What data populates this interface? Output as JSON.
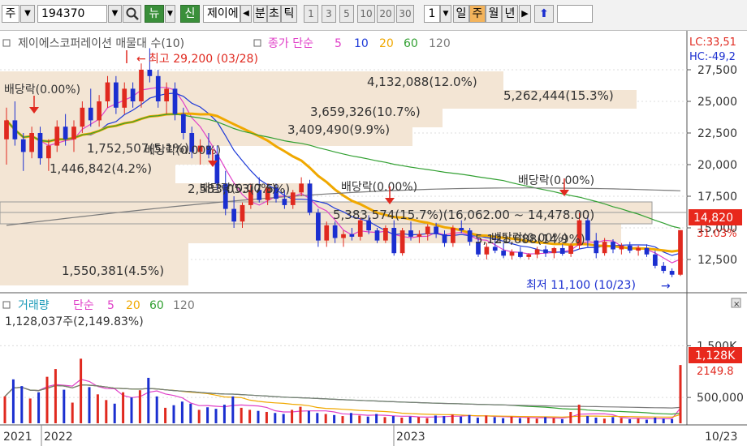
{
  "toolbar": {
    "market_type": "주",
    "code": "194370",
    "search_icon": "search-icon",
    "news_btn": "뉴",
    "new_btn": "신",
    "stock_name": "제이에",
    "nav_left_icon": "triangle-left-icon",
    "period_labels": [
      "분",
      "초",
      "틱"
    ],
    "interval_options": [
      "1",
      "3",
      "5",
      "10",
      "20",
      "30"
    ],
    "count_value": "1",
    "timeframes": [
      "일",
      "주",
      "월",
      "년"
    ],
    "selected_timeframe": "주",
    "nav_right_icon": "triangle-right-icon",
    "up_icon": "up-arrow-icon"
  },
  "price_panel": {
    "legend": {
      "title": "제이에스코퍼레이션 매물대 수(10)",
      "ma_label": "종가 단순",
      "periods": [
        "5",
        "10",
        "20",
        "60",
        "120"
      ]
    },
    "lc_label": "LC:33,51",
    "hc_label": "HC:-49,2",
    "high_marker": "최고 29,200 (03/28)",
    "low_marker": "최저 11,100 (10/23)",
    "dividend_labels": [
      "배당락(0.00%)",
      "배당락(0.00%)",
      "배당락(0.00%)",
      "배당락(0.00%)",
      "배당락(0.00%)",
      "배당락(0.00%)"
    ],
    "volume_profile": [
      {
        "text": "4,132,088(12.0%)"
      },
      {
        "text": "5,262,444(15.3%)"
      },
      {
        "text": "3,659,326(10.7%)"
      },
      {
        "text": "3,409,490(9.9%)"
      },
      {
        "text": "1,752,507(5.1%)"
      },
      {
        "text": "1,446,842(4.2%)"
      },
      {
        "text": "2,583,053(7.5%)"
      },
      {
        "text": "5,383,574(15.7%)(16,062.00 ~ 14,478.00)"
      },
      {
        "text": "5,121,088(14.9%)"
      },
      {
        "text": "1,550,381(4.5%)"
      }
    ],
    "current_price": "14,820",
    "current_change": "31.03%"
  },
  "volume_panel": {
    "legend": {
      "title": "거래량",
      "ma_label": "단순",
      "periods": [
        "5",
        "20",
        "60",
        "120"
      ]
    },
    "last_value_label": "1,128,037주(2,149.83%)",
    "current_volume": "1,128K",
    "current_change": "2149.8",
    "close_icon": "close-icon"
  },
  "x_axis": {
    "labels": [
      "2021",
      "2022",
      "2023",
      "10/23"
    ]
  },
  "colors": {
    "up": "#e0291f",
    "down": "#1b2fd0",
    "ma5": "#e040c8",
    "ma10": "#1e3ad8",
    "ma20": "#f0a800",
    "ma60": "#32a032",
    "ma120": "#7a7a7a",
    "profile_fill": "#f3e5d4",
    "price_tag": "#e8281c"
  },
  "chart_data": {
    "type": "candlestick",
    "price_axis": {
      "ticks": [
        12500,
        15000,
        17500,
        20000,
        22500,
        25000,
        27500
      ],
      "ylim": [
        10800,
        30200
      ]
    },
    "volume_axis": {
      "ticks": [
        500000,
        1500000
      ],
      "ylim": [
        0,
        2150000
      ]
    },
    "candles": [
      [
        22000,
        24500,
        20000,
        23500
      ],
      [
        23500,
        25000,
        21500,
        22000
      ],
      [
        22000,
        22500,
        19500,
        21000
      ],
      [
        21000,
        23000,
        20500,
        22500
      ],
      [
        22500,
        23000,
        20000,
        20500
      ],
      [
        20500,
        22000,
        19500,
        21500
      ],
      [
        21500,
        23500,
        21000,
        23000
      ],
      [
        23000,
        24000,
        21500,
        22000
      ],
      [
        22000,
        23500,
        21000,
        23000
      ],
      [
        23000,
        25000,
        22500,
        24500
      ],
      [
        24500,
        26000,
        23000,
        23500
      ],
      [
        23500,
        25500,
        23000,
        25000
      ],
      [
        25000,
        27000,
        24500,
        26500
      ],
      [
        26500,
        27000,
        24000,
        24500
      ],
      [
        24500,
        26500,
        24000,
        26000
      ],
      [
        26000,
        26500,
        24500,
        25000
      ],
      [
        25000,
        28000,
        24500,
        27500
      ],
      [
        27500,
        29200,
        26500,
        27000
      ],
      [
        27000,
        27500,
        24500,
        25000
      ],
      [
        25000,
        26500,
        24000,
        26000
      ],
      [
        26000,
        26500,
        23500,
        24000
      ],
      [
        24000,
        24500,
        22000,
        22500
      ],
      [
        22500,
        23000,
        20500,
        21000
      ],
      [
        21000,
        22000,
        20000,
        21500
      ],
      [
        21500,
        22500,
        20500,
        20800
      ],
      [
        20800,
        21500,
        18000,
        18500
      ],
      [
        18500,
        19500,
        16000,
        16500
      ],
      [
        16500,
        17500,
        15000,
        15500
      ],
      [
        15500,
        17000,
        15000,
        16800
      ],
      [
        16800,
        18500,
        16500,
        18000
      ],
      [
        18000,
        19000,
        17000,
        17200
      ],
      [
        17200,
        18500,
        16800,
        18200
      ],
      [
        18200,
        18500,
        17000,
        17300
      ],
      [
        17300,
        18000,
        16500,
        16800
      ],
      [
        16800,
        18000,
        16500,
        17800
      ],
      [
        17800,
        19000,
        17500,
        18500
      ],
      [
        18500,
        18800,
        16000,
        16200
      ],
      [
        16200,
        16500,
        13500,
        14000
      ],
      [
        14000,
        15500,
        13500,
        15200
      ],
      [
        15200,
        15500,
        13800,
        14200
      ],
      [
        14200,
        14800,
        13500,
        14500
      ],
      [
        14500,
        15000,
        14000,
        14300
      ],
      [
        14300,
        15800,
        14000,
        15600
      ],
      [
        15600,
        16000,
        14500,
        14800
      ],
      [
        14800,
        15000,
        13800,
        14000
      ],
      [
        14000,
        15200,
        13800,
        15000
      ],
      [
        15000,
        15600,
        12800,
        13000
      ],
      [
        13000,
        15000,
        12800,
        14800
      ],
      [
        14800,
        15500,
        14000,
        14300
      ],
      [
        14300,
        14800,
        13800,
        14500
      ],
      [
        14500,
        15300,
        14000,
        15100
      ],
      [
        15100,
        15400,
        14200,
        14500
      ],
      [
        14500,
        14800,
        13500,
        13800
      ],
      [
        13800,
        15200,
        13500,
        15000
      ],
      [
        15000,
        15600,
        14600,
        14800
      ],
      [
        14800,
        15000,
        13600,
        13900
      ],
      [
        13900,
        14200,
        12700,
        12900
      ],
      [
        12900,
        13800,
        12500,
        13500
      ],
      [
        13500,
        14300,
        13000,
        13200
      ],
      [
        13200,
        13800,
        12600,
        12800
      ],
      [
        12800,
        13300,
        12500,
        13100
      ],
      [
        13100,
        13500,
        12600,
        12700
      ],
      [
        12700,
        13000,
        12500,
        12900
      ],
      [
        12900,
        13500,
        12600,
        13300
      ],
      [
        13300,
        13600,
        12700,
        13000
      ],
      [
        13000,
        13500,
        12600,
        13400
      ],
      [
        13400,
        13700,
        12800,
        12950
      ],
      [
        12950,
        13800,
        12700,
        13600
      ],
      [
        13600,
        16200,
        13300,
        15600
      ],
      [
        15600,
        16000,
        13500,
        14000
      ],
      [
        14000,
        14600,
        12600,
        13000
      ],
      [
        13000,
        14200,
        12800,
        13900
      ],
      [
        13900,
        14100,
        13000,
        13300
      ],
      [
        13300,
        13800,
        12900,
        13600
      ],
      [
        13600,
        13900,
        13000,
        13200
      ],
      [
        13200,
        13600,
        12800,
        13400
      ],
      [
        13400,
        13700,
        12700,
        12900
      ],
      [
        12900,
        13200,
        11800,
        12000
      ],
      [
        12000,
        12300,
        11400,
        11600
      ],
      [
        11600,
        11800,
        11100,
        11300
      ],
      [
        11300,
        14820,
        11200,
        14820
      ]
    ],
    "volume": [
      520000,
      850000,
      720000,
      480000,
      600000,
      900000,
      1050000,
      650000,
      400000,
      1250000,
      700000,
      560000,
      450000,
      380000,
      600000,
      500000,
      640000,
      880000,
      520000,
      300000,
      350000,
      420000,
      380000,
      260000,
      310000,
      280000,
      360000,
      520000,
      300000,
      260000,
      240000,
      220000,
      200000,
      180000,
      260000,
      320000,
      240000,
      200000,
      180000,
      160000,
      140000,
      200000,
      150000,
      130000,
      180000,
      120000,
      140000,
      110000,
      130000,
      120000,
      100000,
      150000,
      140000,
      170000,
      130000,
      160000,
      110000,
      150000,
      120000,
      100000,
      130000,
      100000,
      110000,
      90000,
      120000,
      100000,
      80000,
      220000,
      360000,
      140000,
      110000,
      90000,
      120000,
      100000,
      80000,
      90000,
      70000,
      110000,
      90000,
      80000,
      1128037
    ]
  }
}
